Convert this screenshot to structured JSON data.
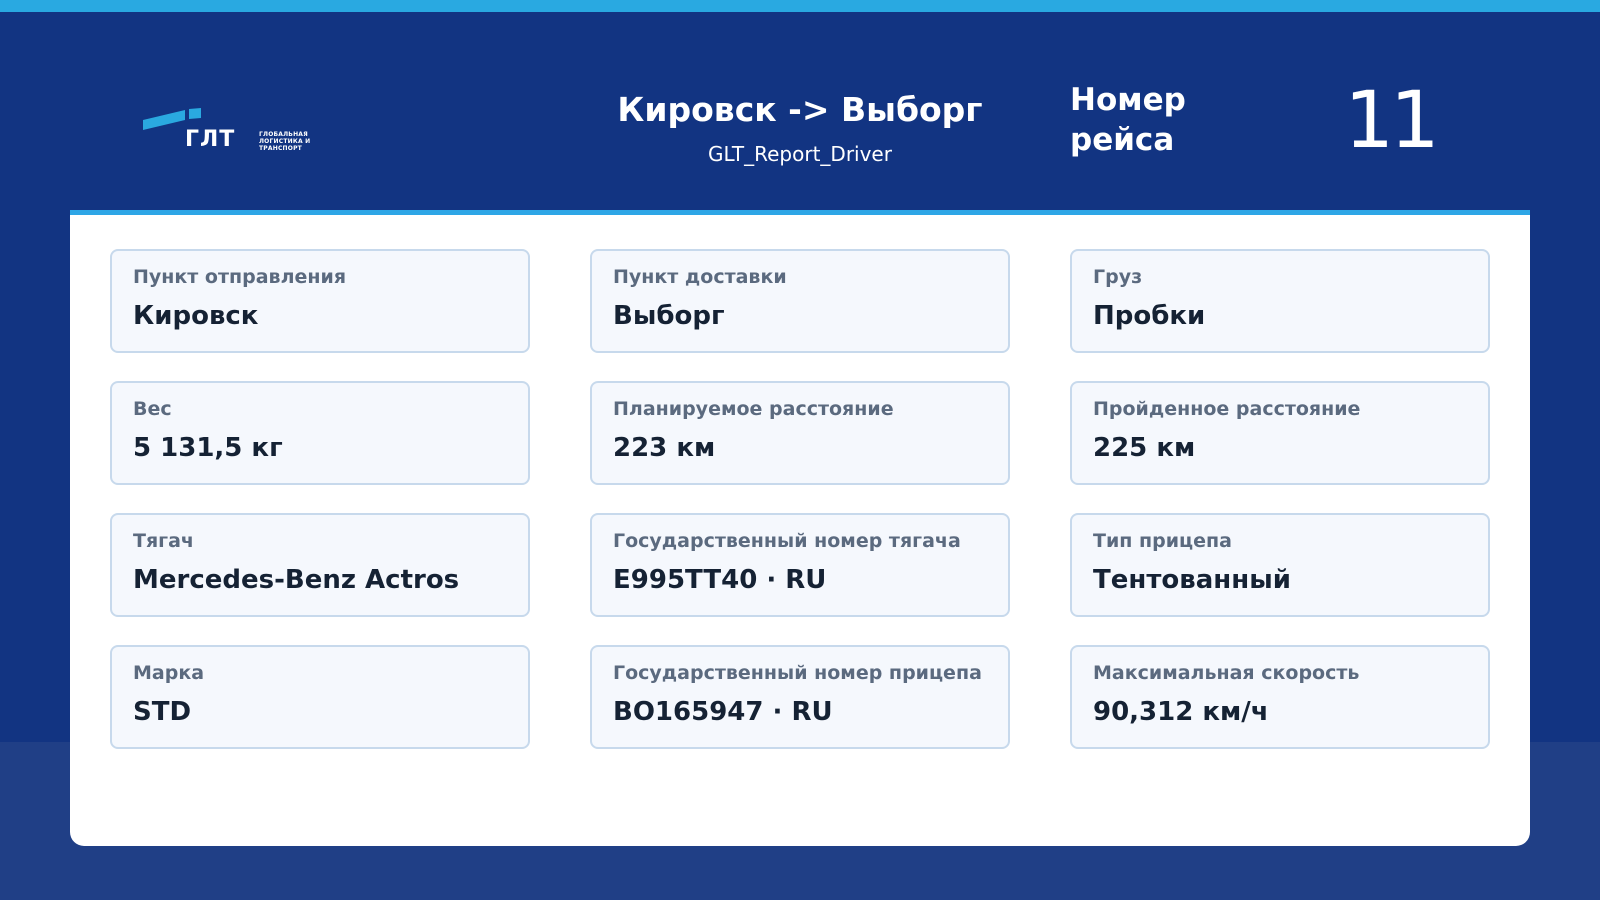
{
  "colors": {
    "header_background": "#123482",
    "top_stripe": "#29a9e1",
    "panel_accent": "#2ea6e6",
    "card_background": "#f5f8fd",
    "card_border": "#c7d9ec",
    "label_text": "#5b6a7f",
    "value_text": "#152234"
  },
  "header": {
    "logo_text": "ГЛТ",
    "logo_caption": "ГЛОБАЛЬНАЯ\nЛОГИСТИКА И\nТРАНСПОРТ",
    "route_title": "Кировск -> Выборг",
    "report_name": "GLT_Report_Driver",
    "trip_label": "Номер рейса",
    "trip_number": "11"
  },
  "cards": [
    {
      "label": "Пункт отправления",
      "value": "Кировск"
    },
    {
      "label": "Пункт доставки",
      "value": "Выборг"
    },
    {
      "label": "Груз",
      "value": "Пробки"
    },
    {
      "label": "Вес",
      "value": "5 131,5 кг"
    },
    {
      "label": "Планируемое расстояние",
      "value": "223 км"
    },
    {
      "label": "Пройденное расстояние",
      "value": "225 км"
    },
    {
      "label": "Тягач",
      "value": "Mercedes-Benz Actros"
    },
    {
      "label": "Государственный номер тягача",
      "value": "E995TT40 · RU"
    },
    {
      "label": "Тип прицепа",
      "value": "Тентованный"
    },
    {
      "label": "Марка",
      "value": "STD"
    },
    {
      "label": "Государственный номер прицепа",
      "value": "BO165947 · RU"
    },
    {
      "label": "Максимальная скорость",
      "value": "90,312 км/ч"
    }
  ]
}
